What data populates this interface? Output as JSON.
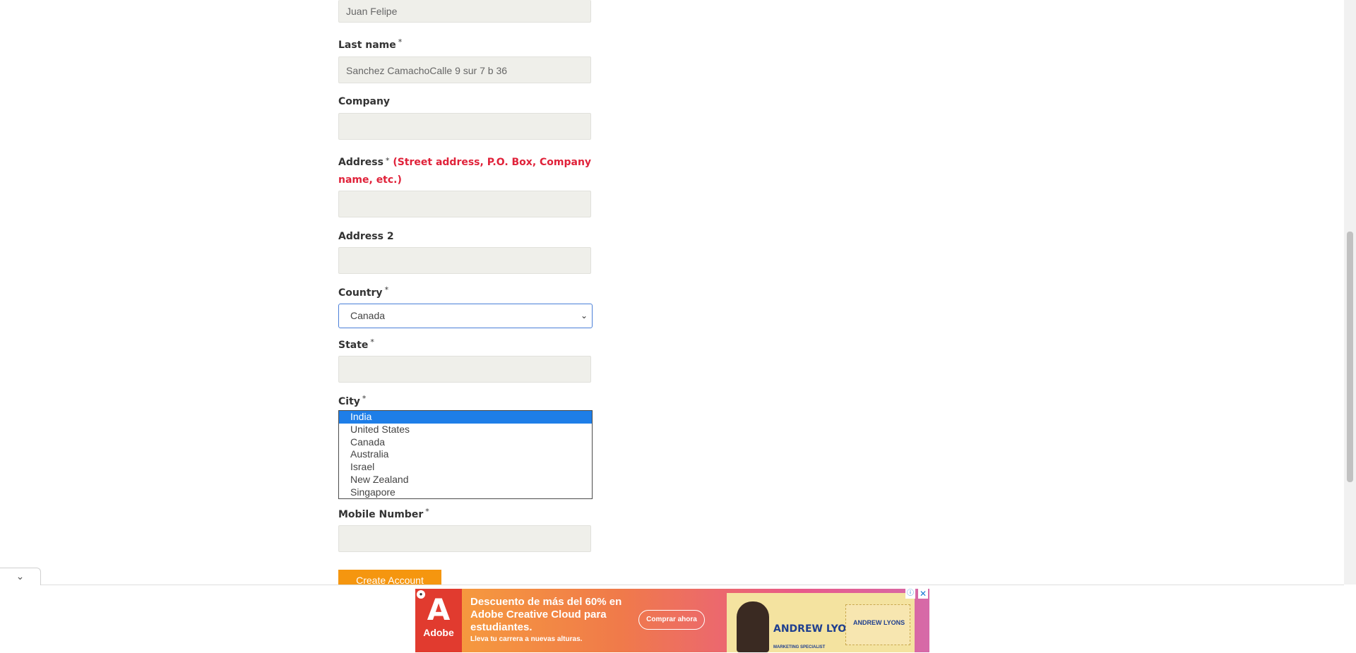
{
  "form": {
    "first_name_value": "Juan Felipe",
    "last_name": {
      "label": "Last name",
      "required_mark": "*",
      "value": "Sanchez CamachoCalle 9 sur 7 b 36"
    },
    "company": {
      "label": "Company",
      "value": ""
    },
    "address": {
      "label": "Address",
      "required_mark": "*",
      "hint": "(Street address, P.O. Box, Company name, etc.)",
      "value": ""
    },
    "address2": {
      "label": "Address 2",
      "value": ""
    },
    "country": {
      "label": "Country",
      "required_mark": "*",
      "selected": "Canada"
    },
    "state": {
      "label": "State",
      "required_mark": "*",
      "value": ""
    },
    "city": {
      "label": "City",
      "required_mark": "*",
      "options": [
        "India",
        "United States",
        "Canada",
        "Australia",
        "Israel",
        "New Zealand",
        "Singapore"
      ],
      "highlighted": "India"
    },
    "mobile": {
      "label": "Mobile Number",
      "required_mark": "*",
      "value": ""
    },
    "submit_label": "Create Account"
  },
  "page": {
    "collapse_icon": "chevron-down-icon"
  },
  "ad": {
    "brand": "Adobe",
    "headline": "Descuento de más del 60% en Adobe Creative Cloud para estudiantes.",
    "subline": "Lleva tu carrera a nuevas alturas.",
    "cta": "Comprar ahora",
    "person_name": "ANDREW LYONS",
    "person_role": "MARKETING SPECIALIST",
    "colors": {
      "accent": "#e13b2f",
      "button": "#f5960f"
    }
  }
}
